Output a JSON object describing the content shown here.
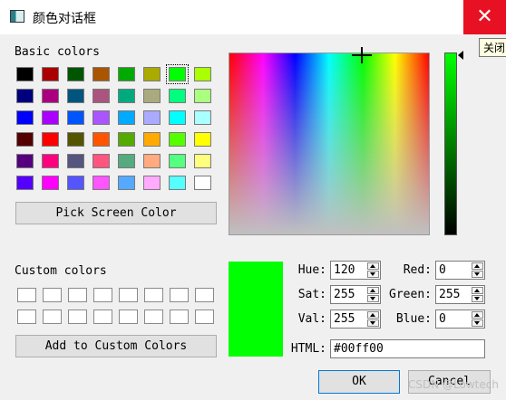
{
  "window": {
    "title": "颜色对话框",
    "close_glyph": "✕",
    "close_tooltip": "关闭"
  },
  "basic_colors": {
    "label": "Basic colors",
    "rows": [
      [
        "#000000",
        "#aa0000",
        "#005500",
        "#aa5500",
        "#00aa00",
        "#aaaa00",
        "#00ff00",
        "#aaff00"
      ],
      [
        "#00007f",
        "#aa007f",
        "#00557f",
        "#aa557f",
        "#00aa7f",
        "#aaaa7f",
        "#00ff7f",
        "#aaff7f"
      ],
      [
        "#0000ff",
        "#aa00ff",
        "#0055ff",
        "#aa55ff",
        "#00aaff",
        "#aaaaff",
        "#00ffff",
        "#aaffff"
      ],
      [
        "#550000",
        "#ff0000",
        "#555500",
        "#ff5500",
        "#55aa00",
        "#ffaa00",
        "#55ff00",
        "#ffff00"
      ],
      [
        "#55007f",
        "#ff007f",
        "#55557f",
        "#ff557f",
        "#55aa7f",
        "#ffaa7f",
        "#55ff7f",
        "#ffff7f"
      ],
      [
        "#5500ff",
        "#ff00ff",
        "#5555ff",
        "#ff55ff",
        "#55aaff",
        "#ffaaff",
        "#55ffff",
        "#ffffff"
      ]
    ],
    "selected_index": [
      0,
      6
    ]
  },
  "pick_screen_button": "Pick Screen Color",
  "custom_colors": {
    "label": "Custom colors",
    "count": 16
  },
  "add_custom_button": "Add to Custom Colors",
  "current_color": "#00ff00",
  "fields": {
    "hue": {
      "label": "Hue:",
      "value": "120"
    },
    "sat": {
      "label": "Sat:",
      "value": "255"
    },
    "val": {
      "label": "Val:",
      "value": "255"
    },
    "red": {
      "label": "Red:",
      "value": "0"
    },
    "green": {
      "label": "Green:",
      "value": "255"
    },
    "blue": {
      "label": "Blue:",
      "value": "0"
    },
    "html": {
      "label": "HTML:",
      "value": "#00ff00"
    }
  },
  "buttons": {
    "ok": "OK",
    "cancel": "Cancel"
  },
  "watermark": "CSDN @Lowtech"
}
